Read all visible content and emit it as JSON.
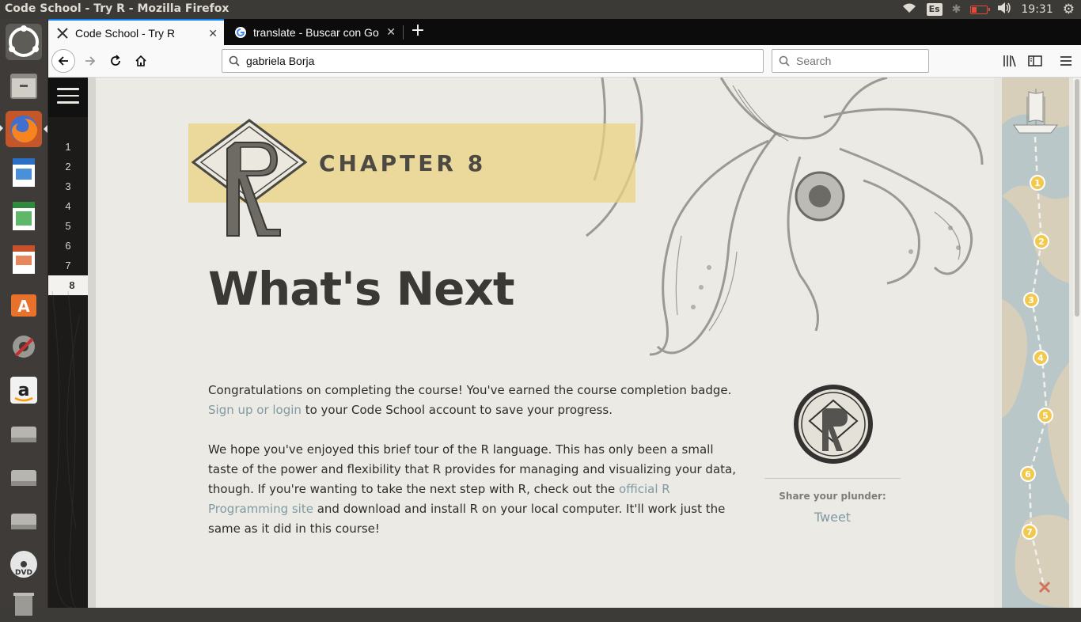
{
  "window": {
    "title": "Code School - Try R - Mozilla Firefox",
    "keyboard_layout": "Es",
    "clock": "19:31"
  },
  "launcher": {
    "items": [
      "ubuntu-dash-icon",
      "files-icon",
      "firefox-icon",
      "writer-icon",
      "calc-icon",
      "impress-icon",
      "software-center-icon",
      "system-settings-icon",
      "amazon-icon",
      "drive-icon",
      "drive-icon",
      "drive-icon",
      "dvd-icon",
      "trash-icon"
    ]
  },
  "browser": {
    "tabs": [
      {
        "label": "Code School - Try R",
        "active": true
      },
      {
        "label": "translate - Buscar con Go",
        "active": false
      }
    ],
    "url": "gabriela Borja",
    "search_placeholder": "Search"
  },
  "sidebar": {
    "chapters": [
      "1",
      "2",
      "3",
      "4",
      "5",
      "6",
      "7",
      "8"
    ],
    "active_chapter": "8"
  },
  "main": {
    "chapter_label": "CHAPTER 8",
    "title": "What's Next",
    "paragraph1": {
      "text_a": "Congratulations on completing the course! You've earned the course completion badge.",
      "link": "Sign up or login",
      "text_b": " to your Code School account to save your progress."
    },
    "paragraph2": {
      "text_a": "We hope you've enjoyed this brief tour of the R language. This has only been a small taste of the power and flexibility that R provides for managing and visualizing your data, though. If you're wanting to take the next step with R, check out the ",
      "link": "official R Programming site",
      "text_b": " and download and install R on your local computer. It'll work just the same as it did in this course!"
    }
  },
  "badge_panel": {
    "share_label": "Share your plunder:",
    "tweet": "Tweet"
  },
  "map": {
    "stops": [
      "1",
      "2",
      "3",
      "4",
      "5",
      "6",
      "7"
    ]
  },
  "colors": {
    "accent_band": "#ead380",
    "link": "#7f9aa0",
    "title": "#3b3935",
    "stop_fill": "#f2c94c"
  }
}
